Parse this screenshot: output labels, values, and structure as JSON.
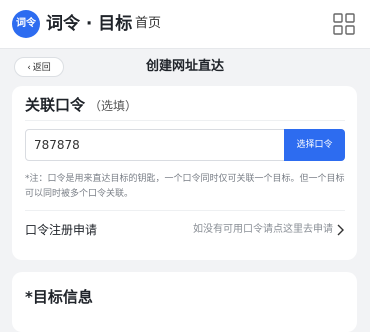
{
  "header": {
    "logo_text": "词令",
    "brand": "词令 · 目标",
    "home": "首页",
    "menu_icon": "grid-icon"
  },
  "subheader": {
    "back_label": "返回",
    "title": "创建网址直达"
  },
  "linked_code": {
    "title": "关联口令",
    "optional": "（选填）",
    "input_value": "787878",
    "select_button": "选择口令",
    "note": "*注：口令是用来直达目标的钥匙，一个口令同时仅可关联一个目标。但一个目标可以同时被多个口令关联。",
    "apply_label": "口令注册申请",
    "apply_hint": "如没有可用口令请点这里去申请"
  },
  "target_info": {
    "title": "*目标信息"
  },
  "colors": {
    "accent": "#2d6cf0",
    "background": "#f2f3f5"
  }
}
